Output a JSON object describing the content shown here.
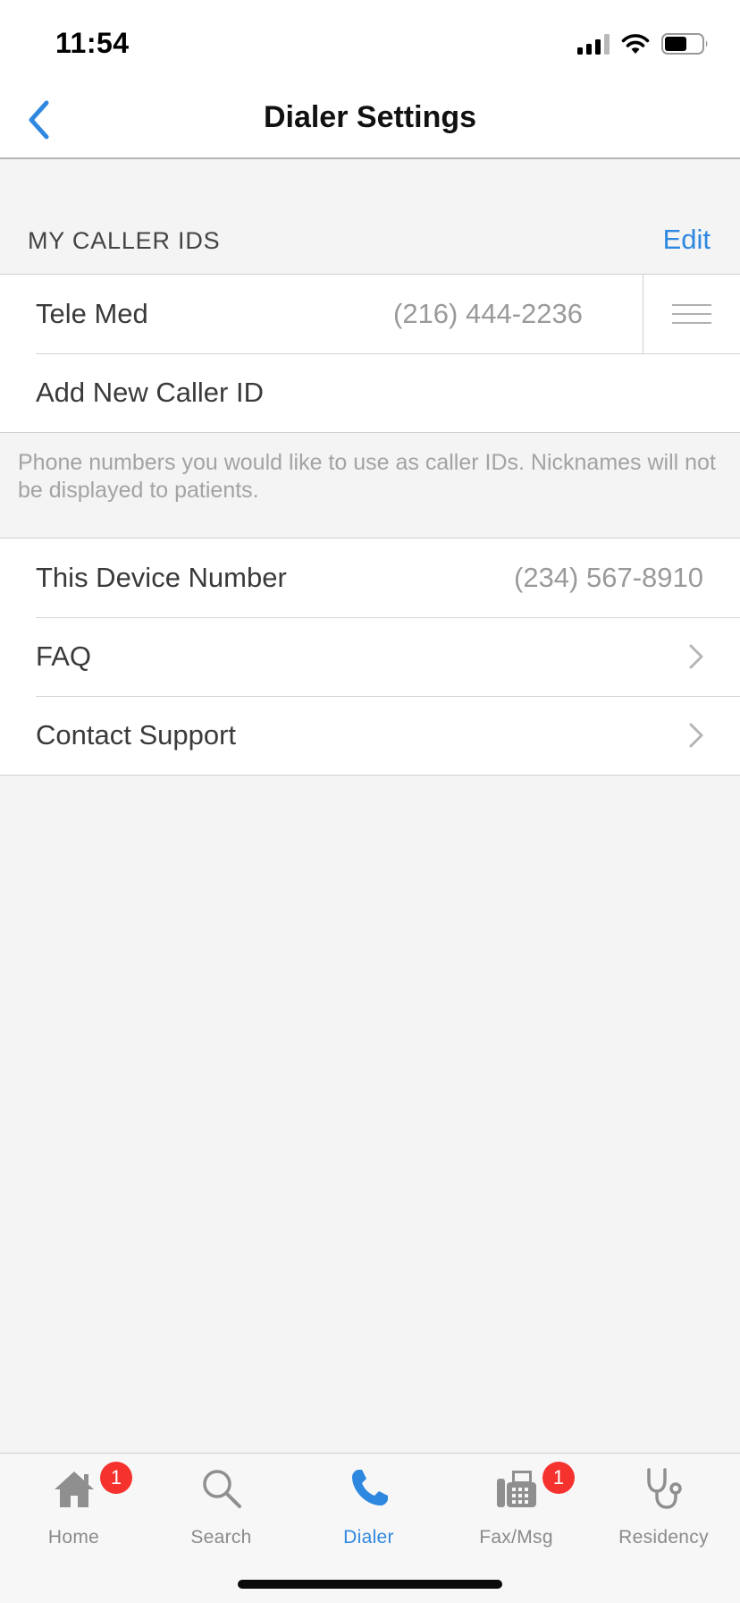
{
  "status_bar": {
    "time": "11:54"
  },
  "nav": {
    "title": "Dialer Settings"
  },
  "caller_ids": {
    "section_title": "MY CALLER IDS",
    "edit_label": "Edit",
    "items": [
      {
        "name": "Tele Med",
        "number": "(216) 444-2236"
      }
    ],
    "add_label": "Add New Caller ID",
    "footer_note": "Phone numbers you would like to use as caller IDs. Nicknames will not be displayed to patients."
  },
  "settings": {
    "device_number_label": "This Device Number",
    "device_number_value": "(234) 567-8910",
    "faq_label": "FAQ",
    "support_label": "Contact Support"
  },
  "tabbar": {
    "tabs": [
      {
        "label": "Home",
        "icon": "home-icon",
        "badge": "1"
      },
      {
        "label": "Search",
        "icon": "search-icon"
      },
      {
        "label": "Dialer",
        "icon": "phone-icon",
        "active": true
      },
      {
        "label": "Fax/Msg",
        "icon": "fax-icon",
        "badge": "1"
      },
      {
        "label": "Residency",
        "icon": "stethoscope-icon"
      }
    ]
  },
  "colors": {
    "accent": "#2f88e0",
    "badge": "#f5322e",
    "background": "#f4f4f5"
  }
}
